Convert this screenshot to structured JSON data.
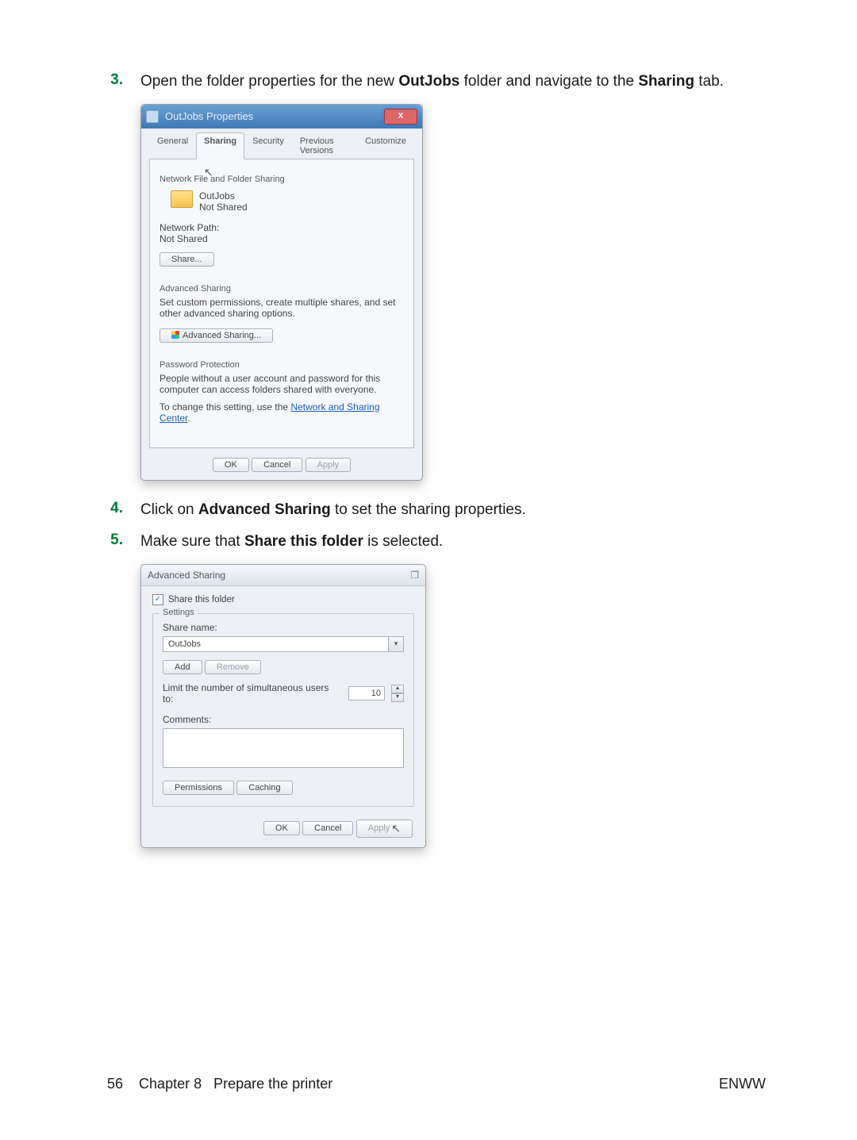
{
  "step3": {
    "num": "3.",
    "pre": "Open the folder properties for the new ",
    "b1": "OutJobs",
    "mid": " folder and navigate to the ",
    "b2": "Sharing",
    "post": " tab."
  },
  "step4": {
    "num": "4.",
    "pre": "Click on ",
    "b1": "Advanced Sharing",
    "post": " to set the sharing properties."
  },
  "step5": {
    "num": "5.",
    "pre": "Make sure that ",
    "b1": "Share this folder",
    "post": " is selected."
  },
  "dlgA": {
    "title": "OutJobs Properties",
    "close": "X",
    "tabs": {
      "general": "General",
      "sharing": "Sharing",
      "security": "Security",
      "prev": "Previous Versions",
      "customize": "Customize"
    },
    "cursor": "↖",
    "sec1_title": "Network File and Folder Sharing",
    "folder_name": "OutJobs",
    "folder_state": "Not Shared",
    "netpath_lbl": "Network Path:",
    "netpath_val": "Not Shared",
    "share_btn": "Share...",
    "sec2_title": "Advanced Sharing",
    "sec2_text": "Set custom permissions, create multiple shares, and set other advanced sharing options.",
    "adv_btn": "Advanced Sharing...",
    "sec3_title": "Password Protection",
    "sec3_text": "People without a user account and password for this computer can access folders shared with everyone.",
    "sec3_text2a": "To change this setting, use the ",
    "sec3_link": "Network and Sharing Center",
    "sec3_text2b": ".",
    "ok": "OK",
    "cancel": "Cancel",
    "apply": "Apply"
  },
  "dlgB": {
    "title": "Advanced Sharing",
    "winicon": "❐",
    "share_chk": "Share this folder",
    "check": "✓",
    "settings": "Settings",
    "sharename_lbl": "Share name:",
    "sharename_val": "OutJobs",
    "dd": "▾",
    "add": "Add",
    "remove": "Remove",
    "limit_lbl": "Limit the number of simultaneous users to:",
    "limit_val": "10",
    "up": "▲",
    "down": "▼",
    "comments": "Comments:",
    "perm": "Permissions",
    "cache": "Caching",
    "ok": "OK",
    "cancel": "Cancel",
    "apply": "Apply",
    "cursor": "↖"
  },
  "footer": {
    "page": "56",
    "chapter_label": "Chapter 8",
    "chapter_title": "Prepare the printer",
    "right": "ENWW"
  }
}
